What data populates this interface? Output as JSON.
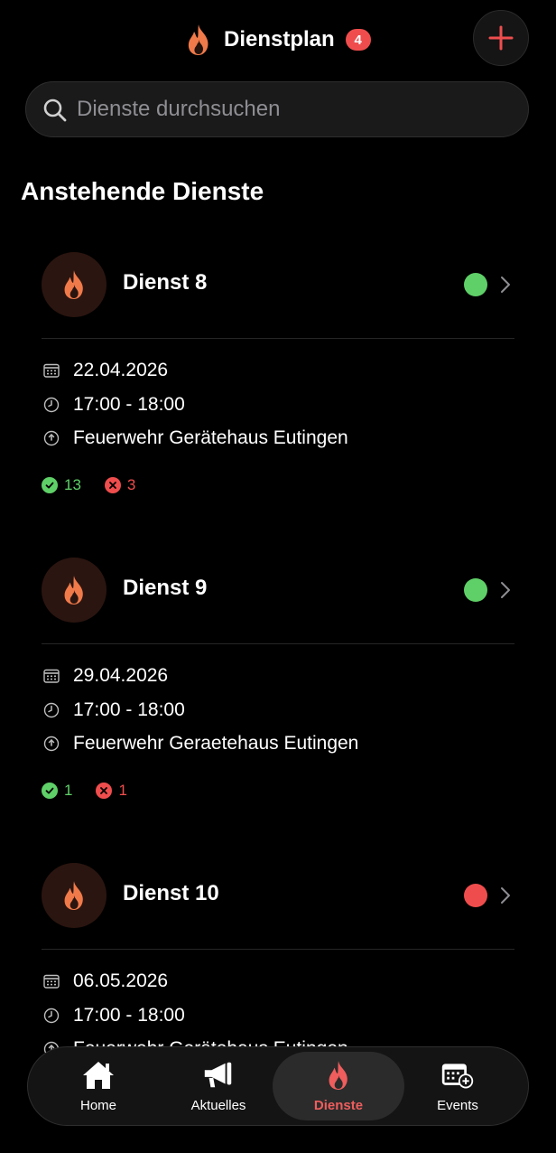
{
  "header": {
    "title": "Dienstplan",
    "badge_count": "4",
    "add_icon": "plus-icon",
    "logo_icon": "flame-icon"
  },
  "search": {
    "placeholder": "Dienste durchsuchen",
    "value": ""
  },
  "section": {
    "title": "Anstehende Dienste"
  },
  "colors": {
    "accent": "#ef4d4d",
    "green": "#5fd068",
    "red": "#ef4d4d",
    "flame_orange": "#f07a4a"
  },
  "services": [
    {
      "title": "Dienst 8",
      "status": "green",
      "date": "22.04.2026",
      "time": "17:00 - 18:00",
      "location": "Feuerwehr Gerätehaus Eutingen",
      "yes_count": "13",
      "no_count": "3"
    },
    {
      "title": "Dienst 9",
      "status": "green",
      "date": "29.04.2026",
      "time": "17:00 - 18:00",
      "location": "Feuerwehr Geraetehaus Eutingen",
      "yes_count": "1",
      "no_count": "1"
    },
    {
      "title": "Dienst 10",
      "status": "red",
      "date": "06.05.2026",
      "time": "17:00 - 18:00",
      "location": "Feuerwehr Gerätehaus Eutingen"
    }
  ],
  "tabbar": {
    "items": [
      {
        "label": "Home",
        "icon": "home-icon"
      },
      {
        "label": "Aktuelles",
        "icon": "megaphone-icon"
      },
      {
        "label": "Dienste",
        "icon": "flame-icon",
        "active": true
      },
      {
        "label": "Events",
        "icon": "calendar-add-icon"
      }
    ]
  }
}
